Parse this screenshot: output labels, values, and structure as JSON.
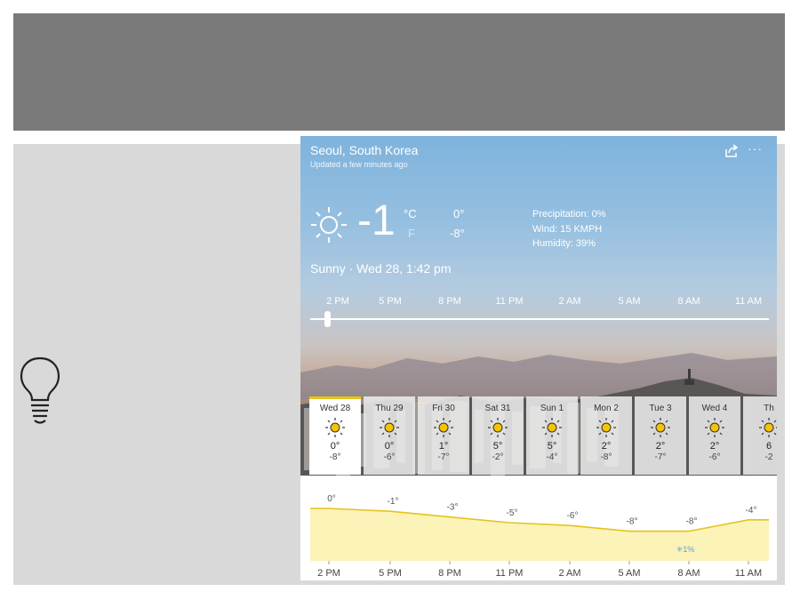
{
  "weather": {
    "location": "Seoul, South Korea",
    "updated": "Updated a few minutes ago",
    "current_temp": "-1",
    "unit_c": "°C",
    "unit_f": "F",
    "hi": "0°",
    "lo": "-8°",
    "precipitation": "Precipitation: 0%",
    "wind": "Wind: 15 KMPH",
    "humidity": "Humidity: 39%",
    "condition": "Sunny · Wed 28, 1:42 pm",
    "hours": [
      "2 PM",
      "5 PM",
      "8 PM",
      "11 PM",
      "2 AM",
      "5 AM",
      "8 AM",
      "11 AM"
    ],
    "more": "···"
  },
  "forecast": [
    {
      "day": "Wed 28",
      "hi": "0°",
      "lo": "-8°"
    },
    {
      "day": "Thu 29",
      "hi": "0°",
      "lo": "-6°"
    },
    {
      "day": "Fri 30",
      "hi": "1°",
      "lo": "-7°"
    },
    {
      "day": "Sat 31",
      "hi": "5°",
      "lo": "-2°"
    },
    {
      "day": "Sun 1",
      "hi": "5°",
      "lo": "-4°"
    },
    {
      "day": "Mon 2",
      "hi": "2°",
      "lo": "-8°"
    },
    {
      "day": "Tue 3",
      "hi": "2°",
      "lo": "-7°"
    },
    {
      "day": "Wed 4",
      "hi": "2°",
      "lo": "-6°"
    },
    {
      "day": "Th",
      "hi": "6",
      "lo": "-2"
    }
  ],
  "chart_data": {
    "type": "area",
    "x": [
      "2 PM",
      "5 PM",
      "8 PM",
      "11 PM",
      "2 AM",
      "5 AM",
      "8 AM",
      "11 AM"
    ],
    "temp_labels": [
      "0°",
      "-1°",
      "-3°",
      "-5°",
      "-6°",
      "-8°",
      "-8°",
      "-4°"
    ],
    "temps": [
      0,
      -1,
      -3,
      -5,
      -6,
      -8,
      -8,
      -4
    ],
    "precip_label": "1%",
    "fill_color": "#fbf3b8",
    "line_color": "#e6c31c"
  },
  "colors": {
    "accent": "#e8c419",
    "sun": "#f5c400",
    "title_band": "#7a7a7a",
    "panel": "#d9d9d9"
  }
}
